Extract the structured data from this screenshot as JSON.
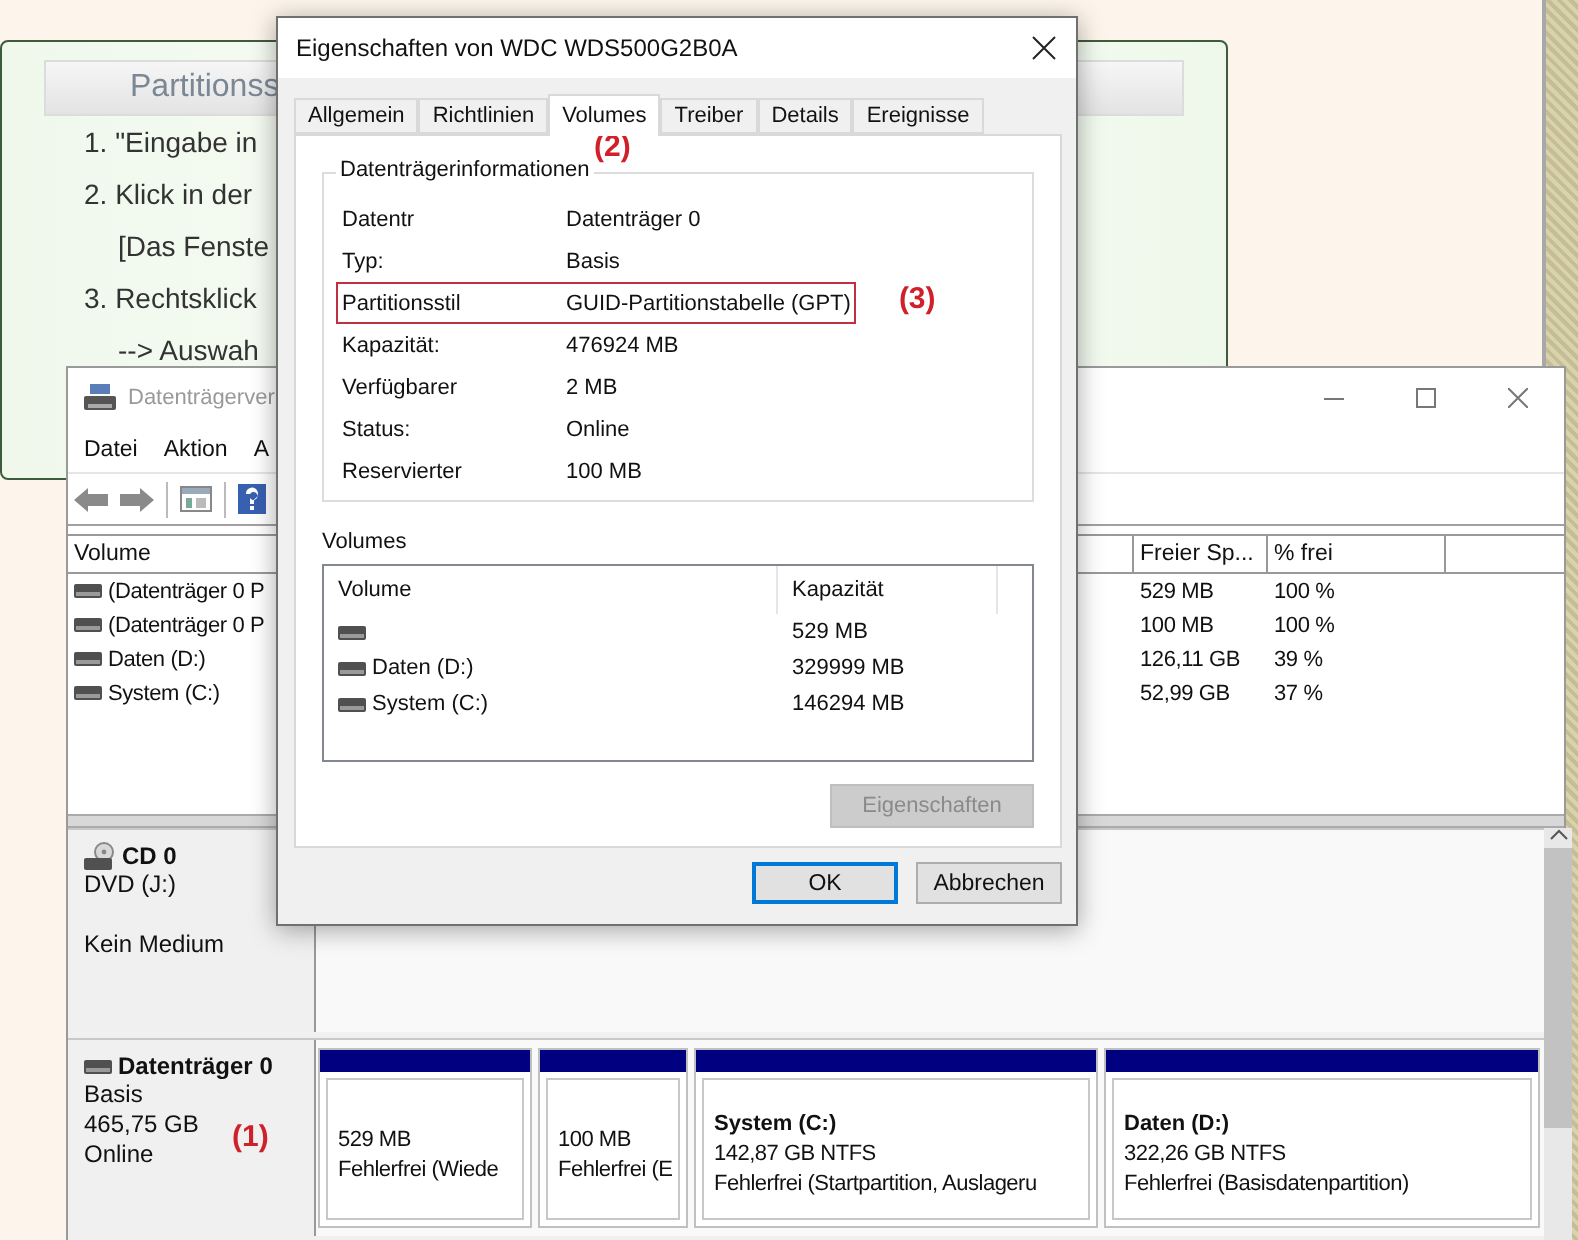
{
  "tutorial": {
    "title": "Partitionss",
    "steps": [
      {
        "lines": [
          "1. \"Eingabe in"
        ]
      },
      {
        "lines": [
          "2. Klick in der",
          "[Das Fenste"
        ]
      },
      {
        "lines": [
          "3. Rechtsklick",
          "--> Auswah"
        ]
      }
    ]
  },
  "disk_management": {
    "title": "Datenträgerver",
    "menu": [
      "Datei",
      "Aktion",
      "A"
    ],
    "volume_table": {
      "columns": [
        "Volume",
        "Freier Sp...",
        "% frei"
      ],
      "rows": [
        {
          "volume": "(Datenträger 0 P",
          "free": "529 MB",
          "percent": "100 %"
        },
        {
          "volume": "(Datenträger 0 P",
          "free": "100 MB",
          "percent": "100 %"
        },
        {
          "volume": "Daten (D:)",
          "free": "126,11 GB",
          "percent": "39 %"
        },
        {
          "volume": "System (C:)",
          "free": "52,99 GB",
          "percent": "37 %"
        }
      ]
    },
    "disks": [
      {
        "kind": "cd",
        "name": "CD 0",
        "lines": [
          "DVD (J:)",
          "Kein Medium"
        ]
      },
      {
        "kind": "disk",
        "name": "Datenträger 0",
        "lines": [
          "Basis",
          "465,75 GB",
          "Online"
        ],
        "annotation": "(1)",
        "partitions": [
          {
            "lines": [
              "529 MB",
              "Fehlerfrei (Wiede"
            ]
          },
          {
            "lines": [
              "100 MB",
              "Fehlerfrei (E"
            ]
          },
          {
            "title": "System  (C:)",
            "lines": [
              "142,87 GB NTFS",
              "Fehlerfrei (Startpartition, Auslageru"
            ]
          },
          {
            "title": "Daten  (D:)",
            "lines": [
              "322,26 GB NTFS",
              "Fehlerfrei (Basisdatenpartition)"
            ]
          }
        ]
      }
    ]
  },
  "dialog": {
    "title": "Eigenschaften von WDC WDS500G2B0A",
    "tabs": [
      {
        "label": "Allgemein",
        "selected": false
      },
      {
        "label": "Richtlinien",
        "selected": false
      },
      {
        "label": "Volumes",
        "selected": true
      },
      {
        "label": "Treiber",
        "selected": false
      },
      {
        "label": "Details",
        "selected": false
      },
      {
        "label": "Ereignisse",
        "selected": false
      }
    ],
    "tab_annotation": "(2)",
    "group_title": "Datenträgerinformationen",
    "info": [
      {
        "label": "Datentr",
        "value": "Datenträger 0",
        "highlighted": false
      },
      {
        "label": "Typ:",
        "value": "Basis",
        "highlighted": false
      },
      {
        "label": "Partitionsstil",
        "value": "GUID-Partitionstabelle (GPT)",
        "highlighted": true,
        "annotation": "(3)"
      },
      {
        "label": "Kapazität:",
        "value": "476924 MB",
        "highlighted": false
      },
      {
        "label": "Verfügbarer",
        "value": "2 MB",
        "highlighted": false
      },
      {
        "label": "Status:",
        "value": "Online",
        "highlighted": false
      },
      {
        "label": "Reservierter",
        "value": "100 MB",
        "highlighted": false
      }
    ],
    "volumes_label": "Volumes",
    "volumes_table": {
      "columns": [
        "Volume",
        "Kapazität"
      ],
      "rows": [
        {
          "capacity": "529 MB"
        },
        {
          "name": "Daten (D:)",
          "capacity": "329999 MB"
        },
        {
          "name": "System (C:)",
          "capacity": "146294 MB"
        }
      ]
    },
    "properties_button": {
      "label": "Eigenschaften",
      "disabled": true
    },
    "buttons": [
      {
        "label": "OK",
        "default": true
      },
      {
        "label": "Abbrechen",
        "default": false
      }
    ]
  }
}
